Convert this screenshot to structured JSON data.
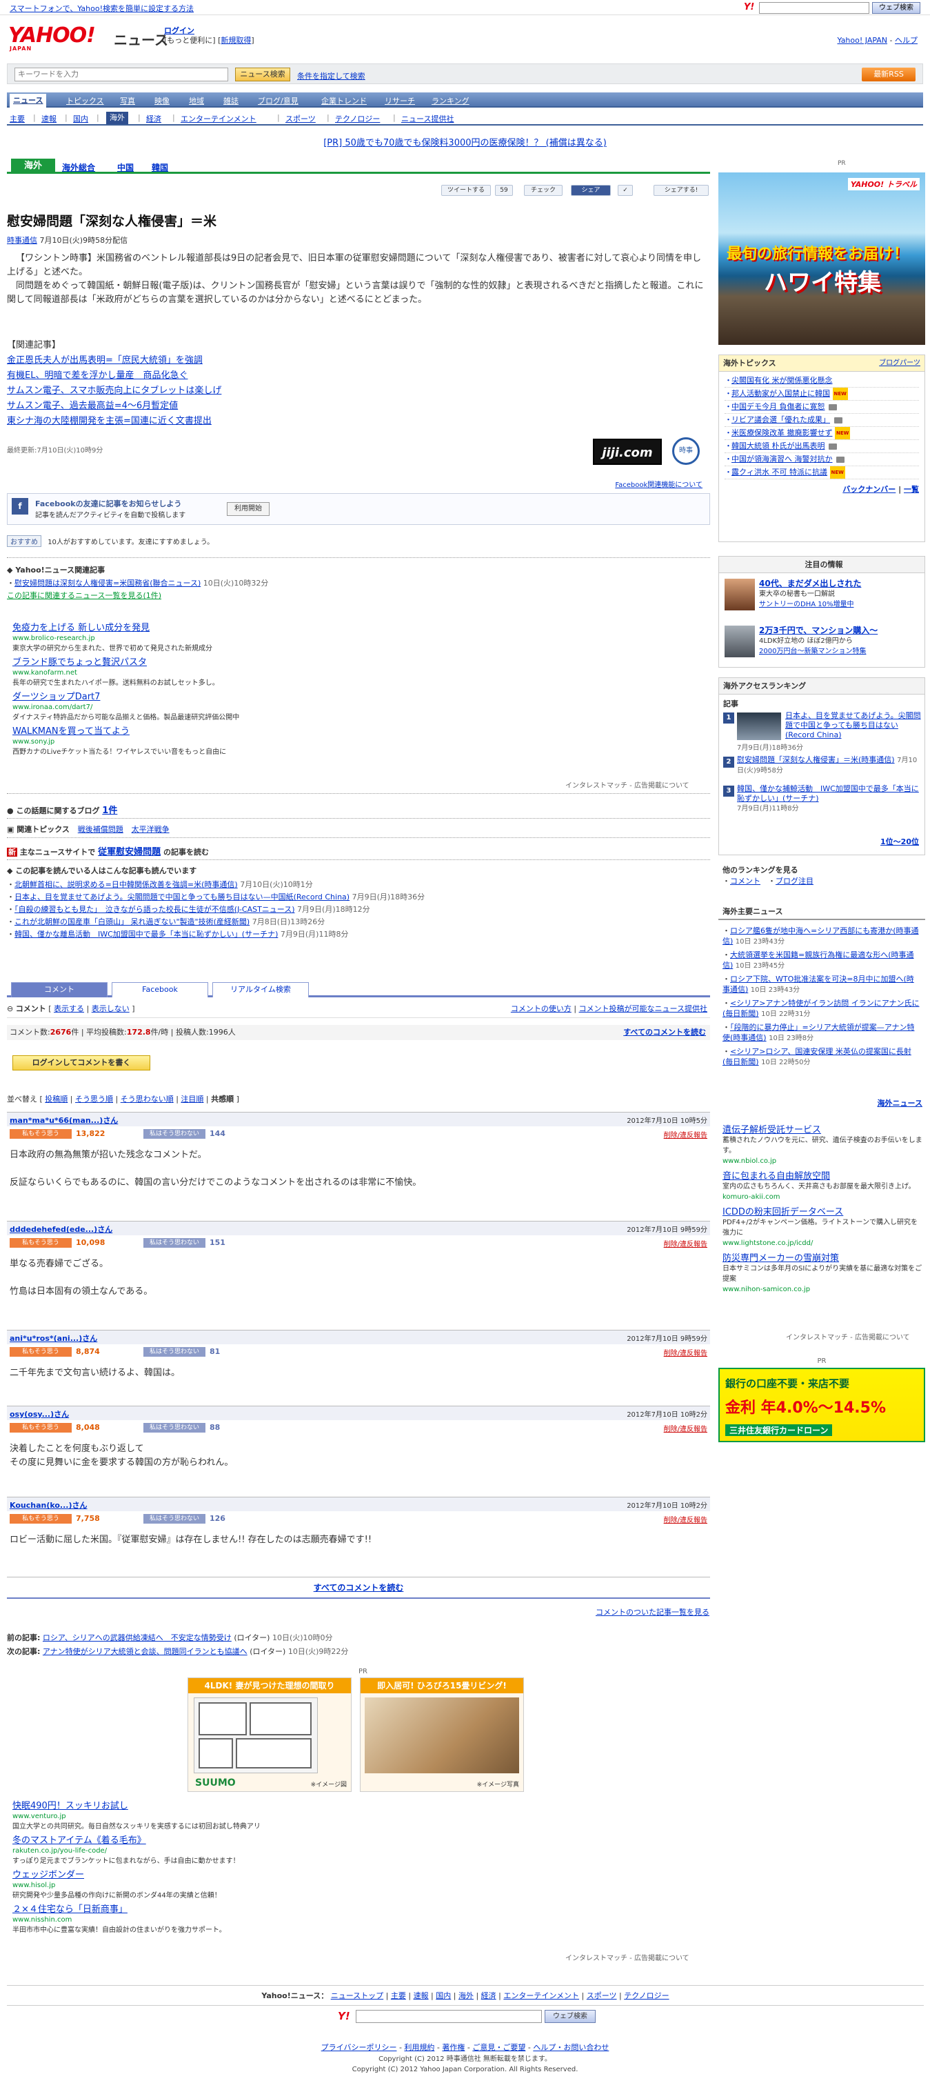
{
  "topbar": {
    "promo": "スマートフォンで、Yahoo!検索を簡単に設定する方法",
    "search_logo": "Y!",
    "search_button": "ウェブ検索"
  },
  "header": {
    "brand": "YAHOO!",
    "brand_sub": "JAPAN",
    "section": "ニュース",
    "login": "ログイン",
    "login_tail": "[もっと便利に]",
    "register": "新規取得",
    "right_link": "Yahoo! JAPAN",
    "right_help": "ヘルプ"
  },
  "search": {
    "placeholder": "キーワードを入力",
    "button": "ニュース検索",
    "cond": "条件を指定して検索",
    "rss": "最新RSS"
  },
  "nav": {
    "main": [
      "ニュース",
      "トピックス",
      "写真",
      "映像",
      "地域",
      "雑誌",
      "ブログ/意見",
      "企業トレンド",
      "リサーチ",
      "ランキング"
    ],
    "sub": [
      "主要",
      "速報",
      "国内",
      "海外",
      "経済",
      "エンターテインメント",
      "スポーツ",
      "テクノロジー",
      "ニュース提供社"
    ]
  },
  "pr_line": "[PR] 50歳でも70歳でも保険料3000円の医療保険！？ (補償は異なる)",
  "cat": {
    "current": "海外",
    "tabs": [
      "海外総合",
      "中国",
      "韓国"
    ]
  },
  "social": {
    "tweet": "ツイートする",
    "tweet_count": "59",
    "check": "チェック",
    "share": "シェア",
    "share2": "シェアする!"
  },
  "article": {
    "title": "慰安婦問題「深刻な人権侵害」＝米",
    "source": "時事通信",
    "date": "7月10日(火)9時58分配信",
    "para1": "【ワシントン時事】米国務省のベントレル報道部長は9日の記者会見で、旧日本軍の従軍慰安婦問題について「深刻な人権侵害であり、被害者に対して哀心より同情を申し上げる」と述べた。",
    "para2": "同問題をめぐって韓国紙・朝鮮日報(電子版)は、クリントン国務長官が「慰安婦」という言葉は誤りで「強制的な性的奴隷」と表現されるべきだと指摘したと報道。これに関して同報道部長は「米政府がどちらの言葉を選択しているのかは分からない」と述べるにとどまった。",
    "related_head": "【関連記事】",
    "related": [
      "金正恩氏夫人が出馬表明=「庶民大統領」を強調",
      "有機EL、明暗で差を浮かし量産　商品化急ぐ",
      "サムスン電子、スマホ販売向上にタブレットは楽しげ",
      "サムスン電子、過去最高益=4～6月暫定値",
      "東シナ海の大陸棚開発を主張=国連に近く文書提出"
    ],
    "updated": "最終更新:7月10日(火)10時9分",
    "logo1": "jiji.com",
    "logo2": "時事",
    "fb_rel": "Facebook関連機能について"
  },
  "facebook": {
    "t1": "Facebookの友達に記事をお知らせしよう",
    "t2": "記事を読んだアクティビティを自動で投稿します",
    "btn": "利用開始",
    "like": "おすすめ",
    "like_text": "10人がおすすめしています。友達にすすめましょう。"
  },
  "yrel": {
    "head": "Yahoo!ニュース関連記事",
    "item": "慰安婦問題は深刻な人権侵害=米国務省(聯合ニュース)",
    "item_date": "10日(火)10時32分",
    "more": "この記事に関連するニュース一覧を見る(1件)"
  },
  "ads1": [
    {
      "t": "免疫力を上げる 新しい成分を発見",
      "u": "www.brolico-research.jp",
      "d": "東京大学の研究から生まれた、世界で初めて発見された新規成分"
    },
    {
      "t": "ブランド豚でちょっと贅沢パスタ",
      "u": "www.kanofarm.net",
      "d": "長年の研究で生まれたハイポー豚。送料無料のお試しセット多し。"
    },
    {
      "t": "ダーツショップDart7",
      "u": "www.ironaa.com/dart7/",
      "d": "ダイナスティ特許品だから可能な品揃えと価格。製品最速研究評価公開中"
    },
    {
      "t": "WALKMANを買って当てよう",
      "u": "www.sony.jp",
      "d": "西野カナのLiveチケット当たる！ワイヤレスでいい音をもっと自由に"
    }
  ],
  "interest": "インタレストマッチ - 広告掲載について",
  "blog": {
    "text": "この話題に関するブログ",
    "count": "1件"
  },
  "topics": {
    "head": "関連トピックス",
    "items": [
      "戦後補償問題",
      "太平洋戦争"
    ]
  },
  "mainsites": {
    "prefix": "主なニュースサイトで",
    "keyword": "従軍慰安婦問題",
    "suffix": "の記事を読む"
  },
  "alsoread": {
    "head": "この記事を読んでいる人はこんな記事も読んでいます",
    "items": [
      [
        "北朝鮮首相に、説明求める=日中韓関係改善を強調=米(時事通信)",
        "7月10日(火)10時1分"
      ],
      [
        "日本よ、目を覚ませてあげよう。尖閣問題で中国と争っても勝ち目はない—中国紙(Record China)",
        "7月9日(月)18時36分"
      ],
      [
        "「自殺の練習もとも見た」　泣きながら語った校長に生徒が不信感(J-CASTニュース)",
        "7月9日(月)18時12分"
      ],
      [
        "これが北朝鮮の国産車「白頭山」 呆れ過ぎない\"製造\"技術(産経新聞)",
        "7月8日(日)13時26分"
      ],
      [
        "韓国、僅かな離島活動　IWC加盟国中で最多「本当に恥ずかしい」(サーチナ)",
        "7月9日(月)11時8分"
      ]
    ]
  },
  "ctabs": [
    "コメント",
    "Facebook",
    "リアルタイム検索"
  ],
  "cbar": {
    "label": "コメント",
    "show": "表示する",
    "hide": "表示しない",
    "howto": "コメントの使い方",
    "prov": "コメント投稿が可能なニュース提供社"
  },
  "cstats": {
    "c_label": "コメント数:",
    "c_val": "2676",
    "c_unit": "件",
    "avg_label": "平均投稿数:",
    "avg_val": "172.8",
    "avg_unit": "件/時",
    "post_label": "投稿人数:",
    "post_val": "1996",
    "post_unit": "人",
    "all": "すべてのコメントを読む"
  },
  "write": "ログインしてコメントを書く",
  "sort": {
    "label": "並べ替え",
    "items": [
      "投稿順",
      "そう思う順",
      "そう思わない順",
      "注目順",
      "共感順"
    ]
  },
  "comments": [
    {
      "user": "man*ma*u*66(man...)",
      "date": "2012年7月10日 10時5分",
      "agree": "13,822",
      "dis": "144",
      "body": "日本政府の無為無策が招いた残念なコメントだ。\n\n反証ならいくらでもあるのに、韓国の言い分だけでこのようなコメントを出されるのは非常に不愉快。"
    },
    {
      "user": "dddedehefed(ede...)",
      "date": "2012年7月10日 9時59分",
      "agree": "10,098",
      "dis": "151",
      "body": "単なる売春婦でござる。\n\n竹島は日本固有の領土なんである。"
    },
    {
      "user": "ani*u*ros*(ani...)",
      "date": "2012年7月10日 9時59分",
      "agree": "8,874",
      "dis": "81",
      "body": "二千年先まで文句言い続けるよ、韓国は。"
    },
    {
      "user": "osy(osy...)",
      "date": "2012年7月10日 10時2分",
      "agree": "8,048",
      "dis": "88",
      "body": "決着したことを何度もぶり返して\nその度に見舞いに金を要求する韓国の方が恥らわれん。"
    },
    {
      "user": "Kouchan(ko...)",
      "date": "2012年7月10日 10時2分",
      "agree": "7,758",
      "dis": "126",
      "body": "ロビー活動に屈した米国。『従軍慰安婦』は存在しません!! 存在したのは志願売春婦です!!"
    }
  ],
  "comment_btn": {
    "agree": "私もそう思う",
    "dis": "私はそう思わない",
    "del": "削除/違反報告",
    "san": "さん"
  },
  "allc": "すべてのコメントを読む",
  "clist": "コメントのついた記事一覧を見る",
  "prevnext": {
    "prev_label": "前の記事:",
    "prev": "ロシア、シリアへの武器供給凍結へ　不安定な情勢受け",
    "prev_src": "(ロイター)",
    "prev_date": "10日(火)10時0分",
    "next_label": "次の記事:",
    "next": "アナン特使がシリア大統領と会談、問題同イランとも協議へ",
    "next_src": "(ロイター)",
    "next_date": "10日(火)9時22分"
  },
  "bottom_pr": "PR",
  "bottomads": [
    {
      "bar": "4LDK! 妻が見つけた理想の間取り",
      "logo": "SUUMO",
      "note": "※イメージ図"
    },
    {
      "bar": "即入居可! ひろびろ15畳リビング!",
      "logo": "",
      "note": "※イメージ写真"
    }
  ],
  "ads2": [
    {
      "t": "快眠490円！スッキリお試し",
      "u": "www.venturo.jp",
      "d": "国立大学との共同研究。毎日自然なスッキリを実感するには初回お試し特典アリ"
    },
    {
      "t": "冬のマストアイテム《着る毛布》",
      "u": "rakuten.co.jp/you-life-code/",
      "d": "すっぽり足元までブランケットに包まれながら、手は自由に動かせます！"
    },
    {
      "t": "ウェッジボンダー",
      "u": "www.hisol.jp",
      "d": "研究開発や少量多品種の作向けに新開のボンダ44年の実績と信頼！"
    },
    {
      "t": "２×４住宅なら「日新商事」",
      "u": "www.nisshin.com",
      "d": "半田市市中心に豊富な実績！自由設計の住まいがりを強力サポート。"
    }
  ],
  "footnav": {
    "label": "Yahoo!ニュース：",
    "items": [
      "ニューストップ",
      "主要",
      "速報",
      "国内",
      "海外",
      "経済",
      "エンターテインメント",
      "スポーツ",
      "テクノロジー"
    ]
  },
  "footlinks": [
    "プライバシーポリシー",
    "利用規約",
    "著作権",
    "ご意見・ご要望",
    "ヘルプ・お問い合わせ"
  ],
  "copy1": "Copyright (C) 2012 時事通信社 無断転載を禁じます。",
  "copy2": "Copyright (C) 2012 Yahoo Japan Corporation. All Rights Reserved.",
  "right": {
    "pr": "PR",
    "hawaii": {
      "brand": "YAHOO! トラベル",
      "l1": "最旬の旅行情報をお届け！",
      "l2": "ハワイ特集"
    },
    "topics": {
      "head": "海外トピックス",
      "right": "ブログパーツ",
      "items": [
        "尖閣国有化 米が関係悪化懸念",
        "邦人活動家が入国禁止に韓国",
        "中国デモ今月 負傷者に寛恕",
        "リビア議会選「優れた成果」",
        "米医療保険改革 撤廃影響せず",
        "韓国大統領 朴氏が出馬表明",
        "中国が領海演習へ 海警対抗か",
        "露クィ洪水 不可 特派に抗議"
      ],
      "back": "バックナンバー",
      "list": "一覧"
    },
    "notice": {
      "head": "注目の情報",
      "i1": "40代、まだダメ出しされた",
      "i1d": "東大卒の秘書も一口解説",
      "i1s": "サントリーのDHA 10%増量中",
      "i2": "2万3千円で、マンション購入～",
      "i2d": "4LDK好立地の ほぼ2億円から",
      "i2s": "2000万円台〜新築マンション特集"
    },
    "ranking": {
      "head": "海外アクセスランキング",
      "sub": "記事",
      "items": [
        [
          "日本よ、目を覚ませてあげよう。尖閣問題で中国と争っても勝ち目はない(Record China)",
          "7月9日(月)18時36分"
        ],
        [
          "慰安婦問題「深刻な人権侵害」＝米(時事通信)",
          "7月10日(火)9時58分"
        ],
        [
          "韓国、僅かな捕鯨活動　IWC加盟国中で最多「本当に恥ずかしい」(サーチナ)",
          "7月9日(月)11時8分"
        ]
      ],
      "more": "1位〜20位"
    },
    "other": {
      "head": "他のランキングを見る",
      "items": [
        "コメント",
        "ブログ注目"
      ]
    },
    "major": {
      "head": "海外主要ニュース",
      "items": [
        [
          "ロシア艦6隻が地中海へ=シリア西部にも寄港か(時事通信)",
          "10日 23時43分"
        ],
        [
          "大統領選挙を米国籍=親族行為権に最適な形へ(時事通信)",
          "10日 23時45分"
        ],
        [
          "ロシア下院、WTO批准法案を可決=8月中に加盟へ(時事通信)",
          "10日 23時43分"
        ],
        [
          "<シリア>アナン特使がイラン訪問 イランにアナン氏に(毎日新聞)",
          "10日 22時31分"
        ],
        [
          "「段階的に暴力停止」=シリア大統領が提案—アナン特使(時事通信)",
          "10日 23時8分"
        ],
        [
          "<シリア>ロシア、国連安保理 米英仏の提案国に長射(毎日新聞)",
          "10日 22時50分"
        ]
      ],
      "more": "海外ニュース"
    },
    "ads": [
      {
        "t": "遺伝子解析受託サービス",
        "u": "www.nbiol.co.jp",
        "d": "蓄積されたノウハウを元に、研究、遺伝子検査のお手伝いをします。"
      },
      {
        "t": "音に包まれる自由解放空間",
        "u": "komuro-akii.com",
        "d": "室内の広さもちろんく、天井高さもお部屋を最大限引き上げ。"
      },
      {
        "t": "ICDDの粉末回折データベース",
        "u": "www.lightstone.co.jp/icdd/",
        "d": "PDF4+/2がキャンペーン価格。ライトストーンで購入し研究を強力に"
      },
      {
        "t": "防災専門メーカーの雪崩対策",
        "u": "www.nihon-samicon.co.jp",
        "d": "日本サミコンは多年月のSIによりがり実績を基に最適な対策をご提案"
      }
    ],
    "pr2": "PR",
    "smbc": {
      "a": "銀行の口座不要・来店不要",
      "b": "金利 年4.0%〜14.5%",
      "c": "三井住友銀行カードローン"
    }
  }
}
